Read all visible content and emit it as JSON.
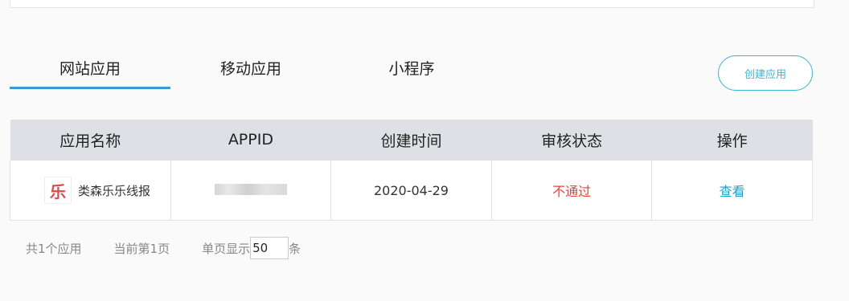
{
  "tabs": [
    {
      "label": "网站应用",
      "active": true
    },
    {
      "label": "移动应用",
      "active": false
    },
    {
      "label": "小程序",
      "active": false
    }
  ],
  "create_button": "创建应用",
  "table": {
    "headers": [
      "应用名称",
      "APPID",
      "创建时间",
      "审核状态",
      "操作"
    ],
    "rows": [
      {
        "logo_text": "乐",
        "name": "类森乐乐线报",
        "appid_hidden": true,
        "created": "2020-04-29",
        "status": "不通过",
        "action": "查看"
      }
    ]
  },
  "footer": {
    "total": "共1个应用",
    "current_page": "当前第1页",
    "page_size_label": "单页显示",
    "page_size_value": "50",
    "page_size_unit": "条"
  },
  "colors": {
    "accent": "#3a98d6",
    "button": "#3bb4cf",
    "status_fail": "#e0463c",
    "link": "#1fa2c8",
    "header_bg": "#dee0e5"
  }
}
